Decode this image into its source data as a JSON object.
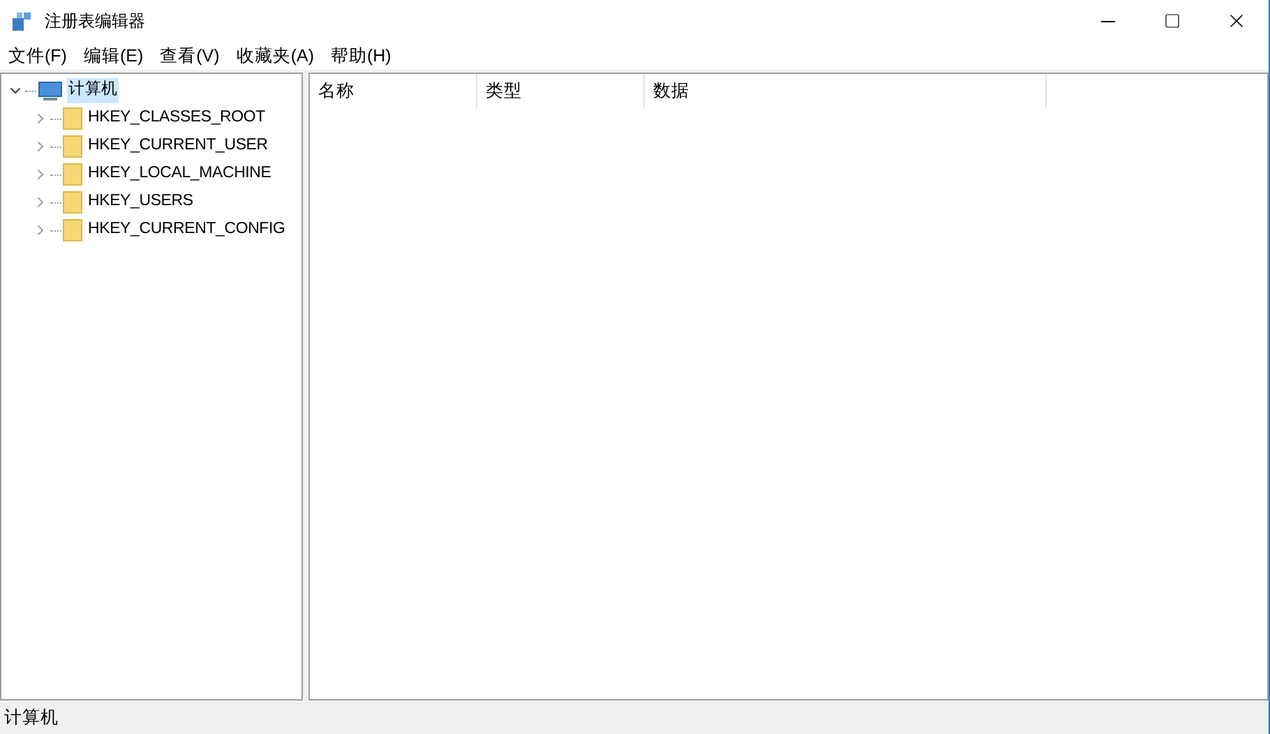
{
  "window": {
    "title": "注册表编辑器"
  },
  "menu": [
    "文件(F)",
    "编辑(E)",
    "查看(V)",
    "收藏夹(A)",
    "帮助(H)"
  ],
  "tree": [
    {
      "label": "计算机",
      "kind": "computer",
      "selected": true,
      "expanded": true,
      "children": [
        {
          "label": "HKEY_CLASSES_ROOT",
          "kind": "folder",
          "selected": false,
          "expanded": false
        },
        {
          "label": "HKEY_CURRENT_USER",
          "kind": "folder",
          "selected": false,
          "expanded": false
        },
        {
          "label": "HKEY_LOCAL_MACHINE",
          "kind": "folder",
          "selected": false,
          "expanded": false
        },
        {
          "label": "HKEY_USERS",
          "kind": "folder",
          "selected": false,
          "expanded": false
        },
        {
          "label": "HKEY_CURRENT_CONFIG",
          "kind": "folder",
          "selected": false,
          "expanded": false
        }
      ]
    }
  ],
  "table": {
    "columns": [
      "名称",
      "类型",
      "数据"
    ]
  },
  "status_bar": "计算机"
}
